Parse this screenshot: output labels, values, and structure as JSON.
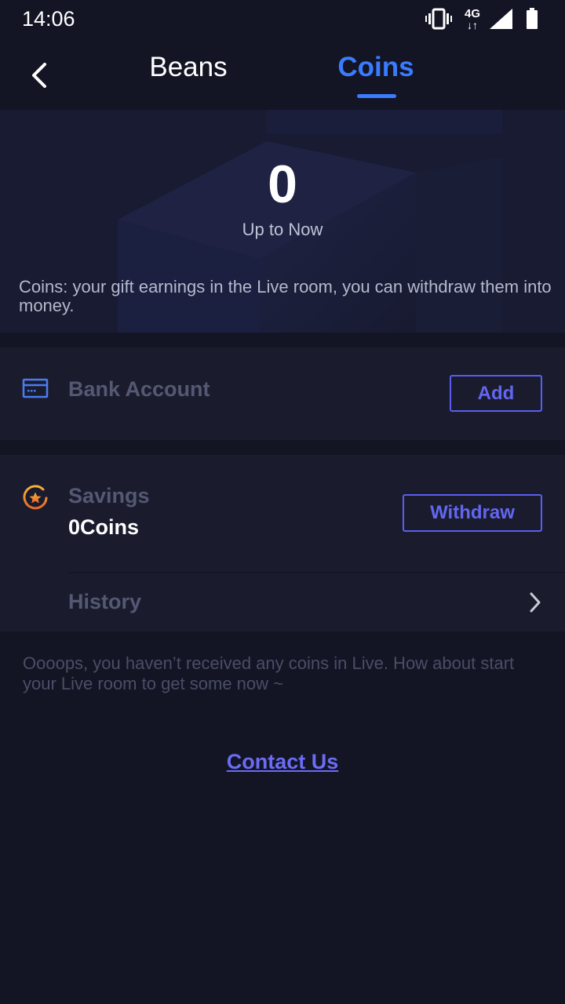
{
  "status_bar": {
    "time": "14:06",
    "network_label": "4G",
    "icons": [
      "vibrate-icon",
      "network-4g-icon",
      "signal-icon",
      "battery-icon"
    ]
  },
  "header": {
    "back_icon": "chevron-left-icon",
    "tabs": [
      {
        "label": "Beans",
        "active": false
      },
      {
        "label": "Coins",
        "active": true
      }
    ]
  },
  "summary": {
    "total": "0",
    "total_label": "Up to Now",
    "description": "Coins: your gift earnings in the Live room, you can withdraw them into money."
  },
  "bank": {
    "icon": "card-icon",
    "label": "Bank Account",
    "add_label": "Add"
  },
  "savings": {
    "icon": "star-coin-icon",
    "label": "Savings",
    "value": "0Coins",
    "withdraw_label": "Withdraw"
  },
  "history": {
    "label": "History",
    "icon": "chevron-right-icon"
  },
  "empty_message": "Oooops, you haven’t received any coins in Live. How about start your Live room to get some now ~",
  "contact_label": "Contact Us",
  "colors": {
    "background": "#131524",
    "card": "#1a1c2e",
    "accent_blue": "#3a7bff",
    "accent_purple": "#6366f1",
    "coin_orange": "#f0902a"
  }
}
